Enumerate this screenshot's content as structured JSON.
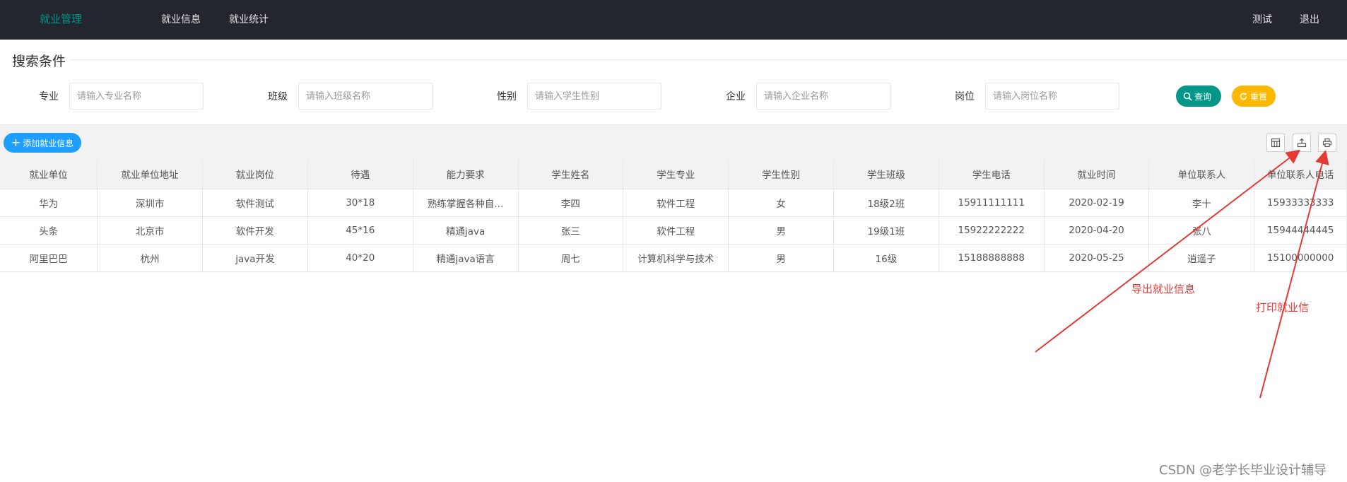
{
  "topnav": {
    "brand": "就业管理",
    "links": [
      "就业信息",
      "就业统计"
    ],
    "user": "测试",
    "logout": "退出"
  },
  "search": {
    "title": "搜索条件",
    "fields": [
      {
        "label": "专业",
        "placeholder": "请输入专业名称",
        "value": ""
      },
      {
        "label": "班级",
        "placeholder": "请输入班级名称",
        "value": ""
      },
      {
        "label": "性别",
        "placeholder": "请输入学生性别",
        "value": ""
      },
      {
        "label": "企业",
        "placeholder": "请输入企业名称",
        "value": ""
      },
      {
        "label": "岗位",
        "placeholder": "请输入岗位名称",
        "value": ""
      }
    ],
    "query_label": "查询",
    "reset_label": "重置"
  },
  "toolbar": {
    "add_label": "添加就业信息",
    "icons": [
      "columns-filter-icon",
      "export-icon",
      "print-icon"
    ]
  },
  "table": {
    "columns": [
      "就业单位",
      "就业单位地址",
      "就业岗位",
      "待遇",
      "能力要求",
      "学生姓名",
      "学生专业",
      "学生性别",
      "学生班级",
      "学生电话",
      "就业时间",
      "单位联系人",
      "单位联系人电话"
    ],
    "rows": [
      [
        "华为",
        "深圳市",
        "软件测试",
        "30*18",
        "熟练掌握各种自...",
        "李四",
        "软件工程",
        "女",
        "18级2班",
        "15911111111",
        "2020-02-19",
        "李十",
        "15933333333"
      ],
      [
        "头条",
        "北京市",
        "软件开发",
        "45*16",
        "精通java",
        "张三",
        "软件工程",
        "男",
        "19级1班",
        "15922222222",
        "2020-04-20",
        "张八",
        "15944444445"
      ],
      [
        "阿里巴巴",
        "杭州",
        "java开发",
        "40*20",
        "精通java语言",
        "周七",
        "计算机科学与技术",
        "男",
        "16级",
        "15188888888",
        "2020-05-25",
        "逍遥子",
        "15100000000"
      ]
    ]
  },
  "annotations": {
    "export": "导出就业信息",
    "print": "打印就业信"
  },
  "watermark": "CSDN @老学长毕业设计辅导",
  "colors": {
    "nav_bg": "#23262e",
    "brand": "#009688",
    "query": "#009688",
    "reset": "#ffb800",
    "add": "#1e9fff",
    "annotation": "#e53935"
  }
}
